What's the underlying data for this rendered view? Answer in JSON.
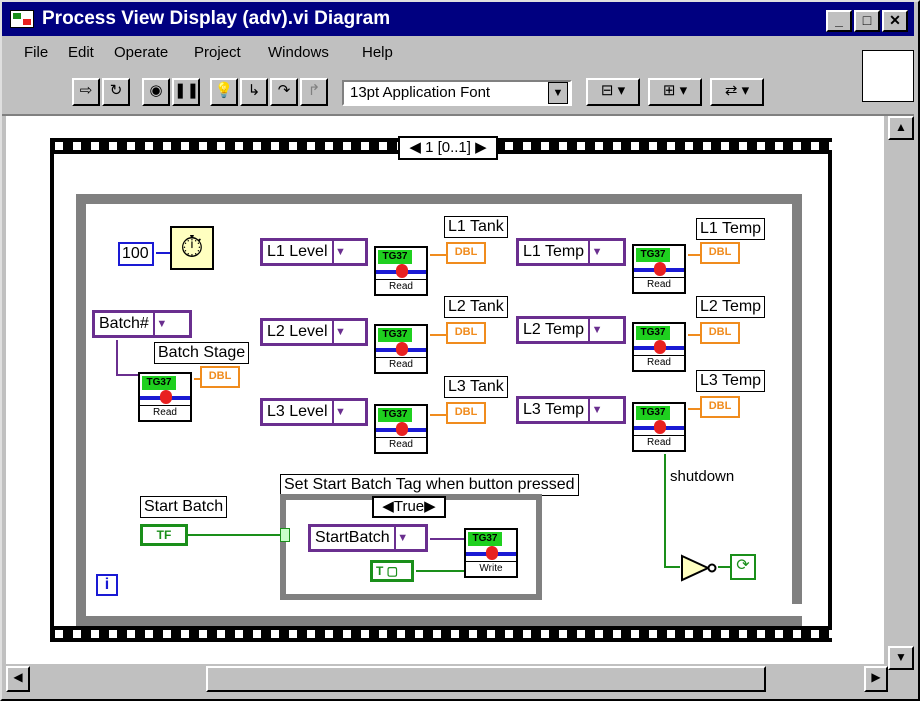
{
  "window": {
    "title": "Process View Display (adv).vi Diagram"
  },
  "window_controls": {
    "minimize": "_",
    "maximize": "□",
    "close": "✕"
  },
  "menu": [
    {
      "label": "File"
    },
    {
      "label": "Edit"
    },
    {
      "label": "Operate"
    },
    {
      "label": "Project"
    },
    {
      "label": "Windows"
    },
    {
      "label": "Help"
    }
  ],
  "toolbar": {
    "font_select": "13pt Application Font",
    "buttons": [
      "run-arrow",
      "run-continuous",
      "abort",
      "pause",
      "highlight-execution",
      "step-into",
      "step-over",
      "step-out",
      "align-objects",
      "distribute-objects",
      "reorder"
    ]
  },
  "sequence": {
    "selector": "1 [0..1]"
  },
  "nodes": {
    "num_const": "100",
    "batch_tag": "Batch#",
    "batch_stage_label": "Batch Stage",
    "l1_level": "L1 Level",
    "l2_level": "L2 Level",
    "l3_level": "L3 Level",
    "l1_temp": "L1 Temp",
    "l2_temp": "L2 Temp",
    "l3_temp": "L3 Temp",
    "l1_tank": "L1 Tank",
    "l2_tank": "L2 Tank",
    "l3_tank": "L3 Tank",
    "l1_temp_ind": "L1 Temp",
    "l2_temp_ind": "L2 Temp",
    "l3_temp_ind": "L3 Temp",
    "dbl": "DBL",
    "tg_name": "TG37",
    "read": "Read",
    "write": "Write",
    "start_batch_label": "Start Batch",
    "tf": "TF",
    "case_comment": "Set Start Batch Tag when button pressed",
    "case_selector": "True",
    "start_batch_tag": "StartBatch",
    "true_const": "T",
    "shutdown": "shutdown",
    "loop_iter": "i"
  }
}
